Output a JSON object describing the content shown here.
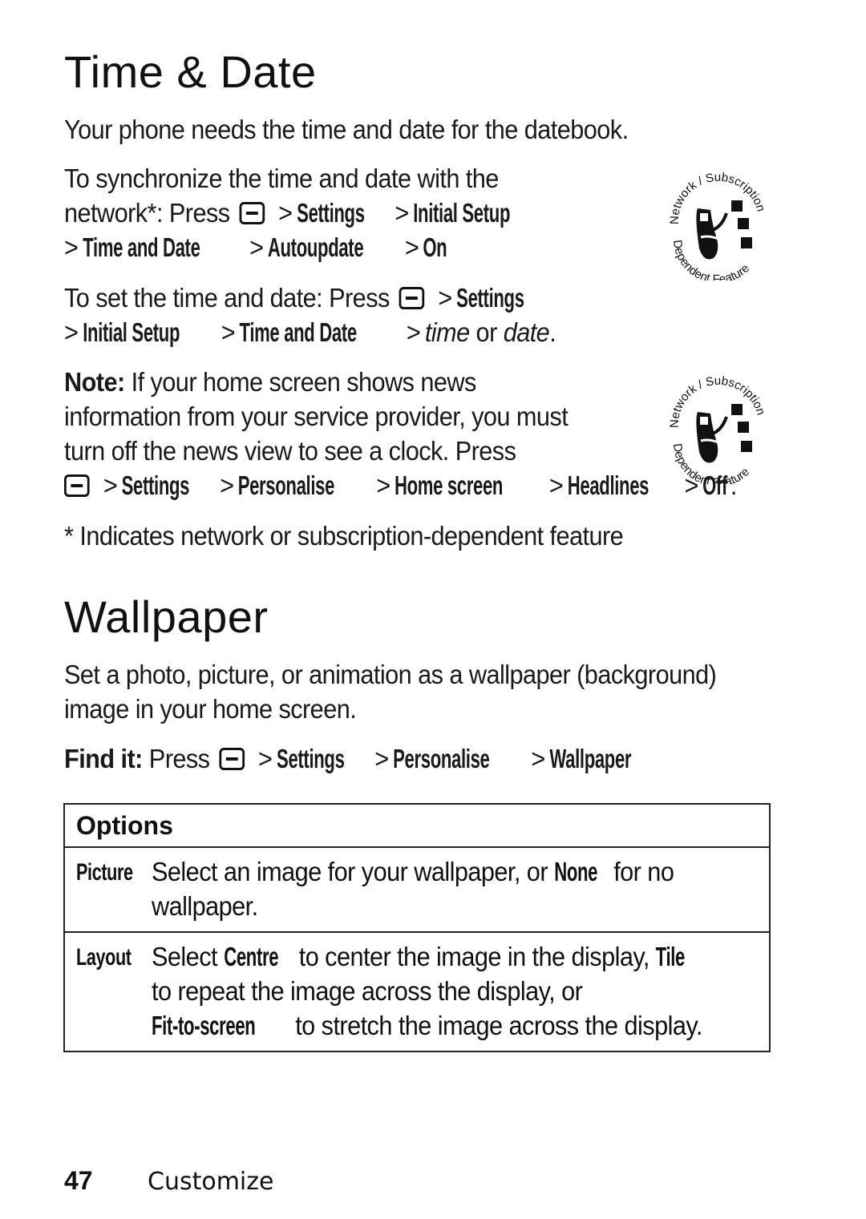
{
  "time_date": {
    "title": "Time & Date",
    "intro": "Your phone needs the time and date for the datebook.",
    "sync": {
      "lead_1": "To synchronize the time and date with the",
      "lead_2": "network*: Press",
      "path": [
        "Settings",
        "Initial Setup",
        "Time and Date",
        "Autoupdate",
        "On"
      ]
    },
    "set": {
      "lead": "To set the time and date: Press",
      "path": [
        "Settings",
        "Initial Setup",
        "Time and Date"
      ],
      "tail_italic_1": "time",
      "tail_or": " or ",
      "tail_italic_2": "date",
      "tail_end": "."
    },
    "note": {
      "label": "Note:",
      "line_1": " If your home screen shows news",
      "line_2": "information from your service provider, you must",
      "line_3": "turn off the news view to see a clock. Press",
      "path": [
        "Settings",
        "Personalise",
        "Home screen",
        "Headlines",
        "Off"
      ],
      "end": "."
    },
    "footnote": "* Indicates network or subscription-dependent feature",
    "badge": {
      "icon": "network-subscription-dependent-feature-icon",
      "top_text": "Network / Subscription",
      "bottom_text": "Dependent Feature"
    }
  },
  "wallpaper": {
    "title": "Wallpaper",
    "intro_1": "Set a photo, picture, or animation as a wallpaper (background)",
    "intro_2": "image in your home screen.",
    "find_it": {
      "label": "Find it:",
      "lead": " Press",
      "path": [
        "Settings",
        "Personalise",
        "Wallpaper"
      ]
    },
    "options": {
      "header": "Options",
      "rows": [
        {
          "name": "Picture",
          "desc_1": "Select an image for your wallpaper, or ",
          "desc_bold_1": "None",
          "desc_2": " for no",
          "desc_3": "wallpaper."
        },
        {
          "name": "Layout",
          "desc_1": "Select ",
          "desc_bold_1": "Centre",
          "desc_2": " to center the image in the display, ",
          "desc_bold_2": "Tile",
          "desc_3": "to repeat the image across the display, or",
          "desc_bold_3": "Fit-to-screen",
          "desc_4": " to stretch the image across the display."
        }
      ]
    }
  },
  "menu_key_icon": "menu-key-icon",
  "separator": ">",
  "footer": {
    "page_number": "47",
    "section": "Customize"
  }
}
